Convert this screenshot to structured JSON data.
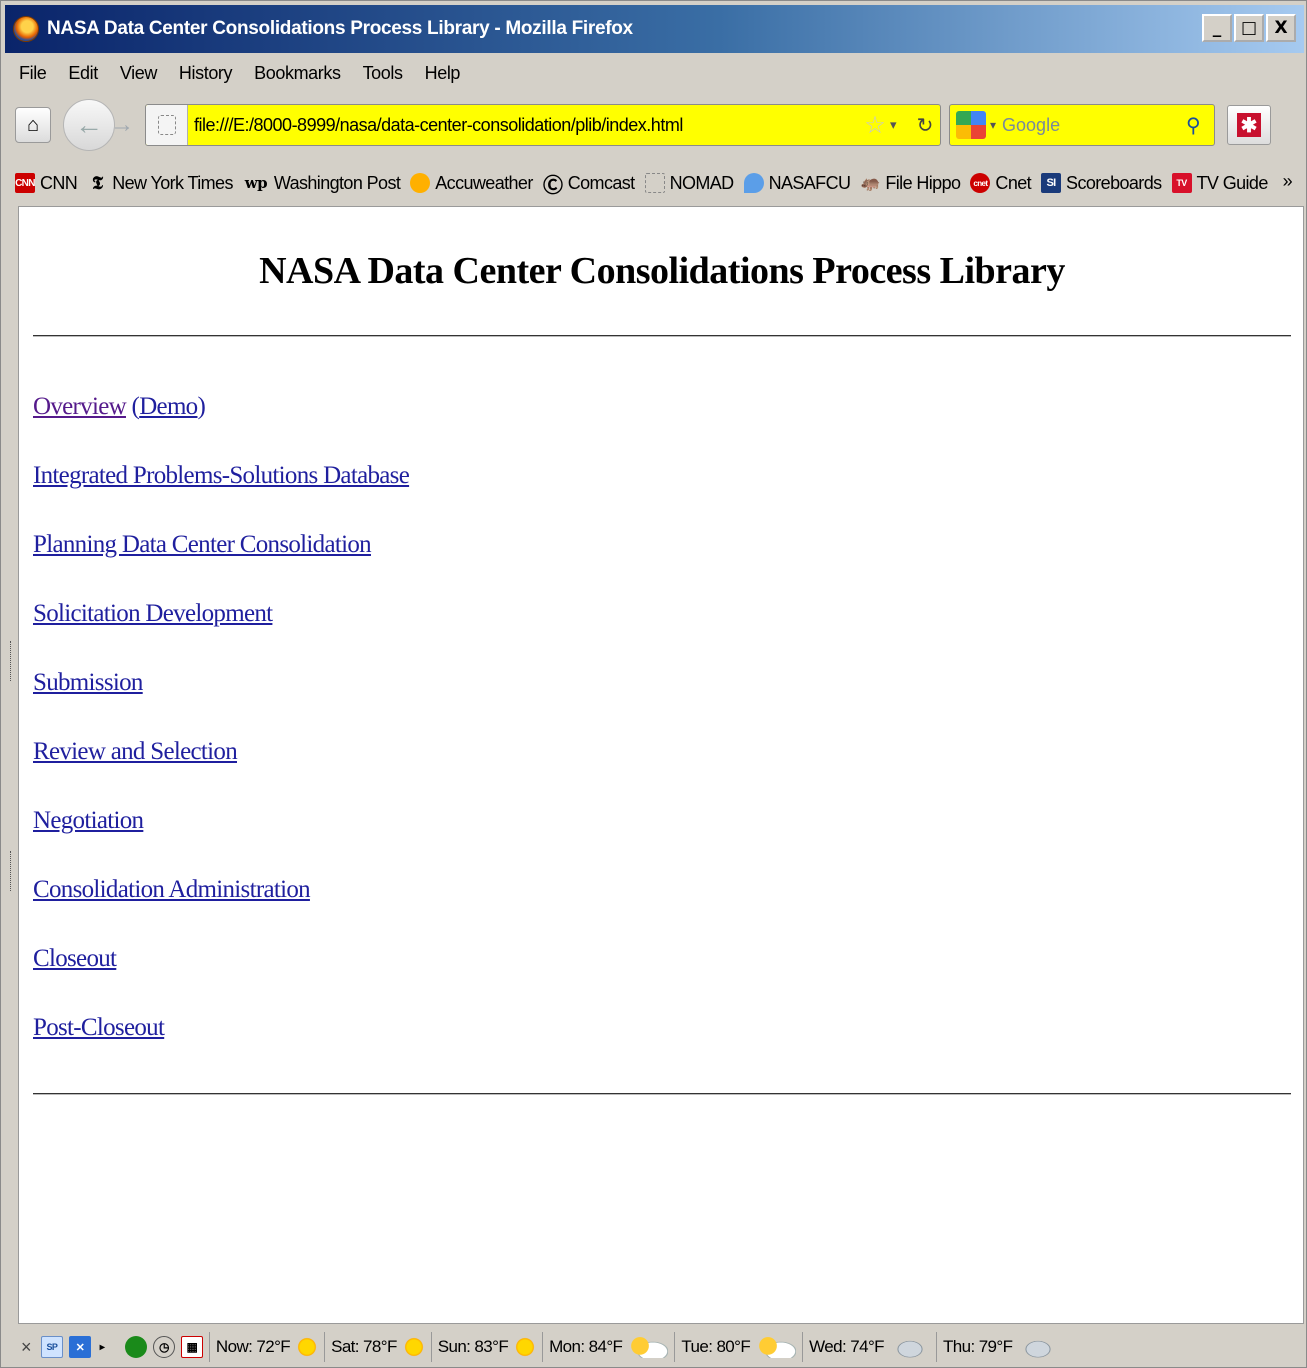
{
  "window": {
    "title": "NASA Data Center Consolidations Process Library - Mozilla Firefox",
    "controls": [
      "_",
      "□",
      "X"
    ]
  },
  "menubar": [
    "File",
    "Edit",
    "View",
    "History",
    "Bookmarks",
    "Tools",
    "Help"
  ],
  "navbar": {
    "url": "file:///E:/8000-8999/nasa/data-center-consolidation/plib/index.html",
    "search_placeholder": "Google",
    "url_bar_color": "#ffff00"
  },
  "bookmarks": [
    {
      "label": "CNN",
      "icon": "cnn-icon",
      "color": "#cc0000"
    },
    {
      "label": "New York Times",
      "icon": "nyt-icon",
      "color": "#000000"
    },
    {
      "label": "Washington Post",
      "icon": "wapo-icon",
      "color": "#000000"
    },
    {
      "label": "Accuweather",
      "icon": "accuweather-icon",
      "color": "#ff8a00"
    },
    {
      "label": "Comcast",
      "icon": "comcast-icon",
      "color": "#000000"
    },
    {
      "label": "NOMAD",
      "icon": "page-icon",
      "color": "#888888"
    },
    {
      "label": "NASAFCU",
      "icon": "nasafcu-icon",
      "color": "#2a6fd6"
    },
    {
      "label": "File Hippo",
      "icon": "filehippo-icon",
      "color": "#444444"
    },
    {
      "label": "Cnet",
      "icon": "cnet-icon",
      "color": "#cc0000"
    },
    {
      "label": "Scoreboards",
      "icon": "si-icon",
      "color": "#1a3a7a"
    },
    {
      "label": "TV Guide",
      "icon": "tvguide-icon",
      "color": "#d8102a"
    }
  ],
  "page": {
    "title": "NASA Data Center Consolidations Process Library",
    "overview": "Overview",
    "demo": "Demo",
    "open_paren": "(",
    "close_paren": ")",
    "links": [
      "Integrated Problems-Solutions Database",
      "Planning Data Center Consolidation",
      "Solicitation Development",
      "Submission",
      "Review and Selection",
      "Negotiation",
      "Consolidation Administration",
      "Closeout",
      "Post-Closeout"
    ]
  },
  "statusbar": {
    "close": "×",
    "weather": [
      {
        "label": "Now: 72°F",
        "icon": "sun-icon"
      },
      {
        "label": "Sat: 78°F",
        "icon": "sun-icon"
      },
      {
        "label": "Sun: 83°F",
        "icon": "sun-icon"
      },
      {
        "label": "Mon: 84°F",
        "icon": "partly-cloudy-icon"
      },
      {
        "label": "Tue: 80°F",
        "icon": "partly-cloudy-icon"
      },
      {
        "label": "Wed: 74°F",
        "icon": "rain-cloud-icon"
      },
      {
        "label": "Thu: 79°F",
        "icon": "rain-cloud-icon"
      }
    ]
  }
}
